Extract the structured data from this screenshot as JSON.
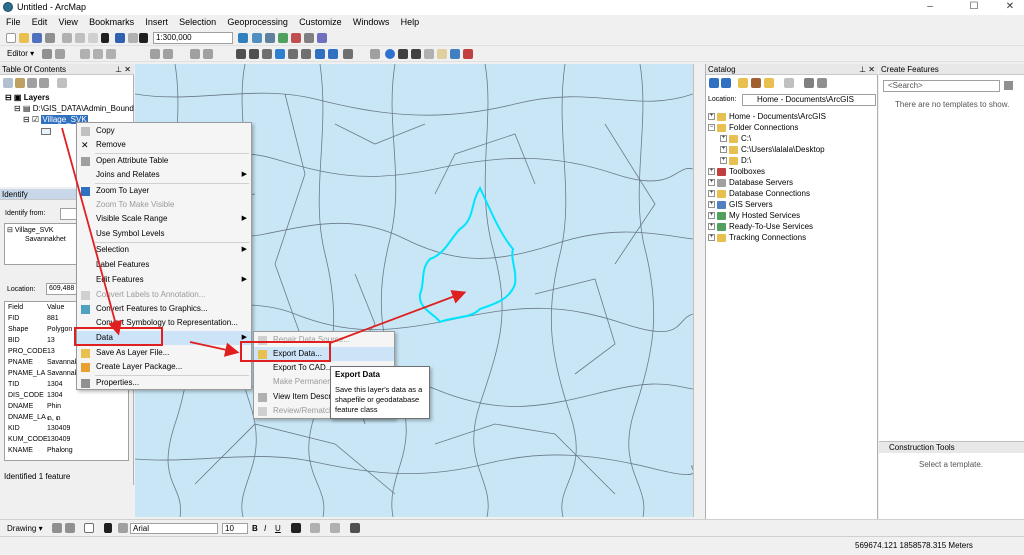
{
  "window": {
    "title": "Untitled - ArcMap",
    "minimize": "–",
    "maximize": "☐",
    "close": "✕"
  },
  "menu": [
    "File",
    "Edit",
    "View",
    "Bookmarks",
    "Insert",
    "Selection",
    "Geoprocessing",
    "Customize",
    "Windows",
    "Help"
  ],
  "toolbar": {
    "scale": "1:300,000",
    "editor_label": "Editor ▾"
  },
  "toc": {
    "title": "Table Of Contents",
    "layers_label": "Layers",
    "group_label": "D:\\GIS_DATA\\Admin_Bound",
    "layer_label": "Village_SVK"
  },
  "identify": {
    "title": "Identify",
    "identify_from_label": "Identify from:",
    "tree_layer": "Village_SVK",
    "tree_feature": "Savannakhet",
    "location_label": "Location:",
    "location_value": "609,488",
    "field_header": "Field",
    "value_header": "Value",
    "fields": [
      {
        "name": "FID",
        "value": "881"
      },
      {
        "name": "Shape",
        "value": "Polygon"
      },
      {
        "name": "BID",
        "value": "13"
      },
      {
        "name": "PRO_CODE",
        "value": "13"
      },
      {
        "name": "PNAME",
        "value": "Savannak"
      },
      {
        "name": "PNAME_LA",
        "value": "Savannak"
      },
      {
        "name": "TID",
        "value": "1304"
      },
      {
        "name": "DIS_CODE",
        "value": "1304"
      },
      {
        "name": "DNAME",
        "value": "Phin"
      },
      {
        "name": "DNAME_LA",
        "value": "ຄ, ຄ"
      },
      {
        "name": "KID",
        "value": "130409"
      },
      {
        "name": "KUM_CODE",
        "value": "130409"
      },
      {
        "name": "KNAME",
        "value": "Phalong"
      }
    ],
    "status": "Identified 1 feature"
  },
  "context_menu": {
    "items": [
      {
        "label": "Copy",
        "disabled": false,
        "submenu": false
      },
      {
        "label": "Remove",
        "disabled": false,
        "submenu": false
      },
      {
        "label": "Open Attribute Table",
        "disabled": false,
        "submenu": false
      },
      {
        "label": "Joins and Relates",
        "disabled": false,
        "submenu": true
      },
      {
        "label": "Zoom To Layer",
        "disabled": false,
        "submenu": false
      },
      {
        "label": "Zoom To Make Visible",
        "disabled": true,
        "submenu": false
      },
      {
        "label": "Visible Scale Range",
        "disabled": false,
        "submenu": true
      },
      {
        "label": "Use Symbol Levels",
        "disabled": false,
        "submenu": false
      },
      {
        "label": "Selection",
        "disabled": false,
        "submenu": true
      },
      {
        "label": "Label Features",
        "disabled": false,
        "submenu": false
      },
      {
        "label": "Edit Features",
        "disabled": false,
        "submenu": true
      },
      {
        "label": "Convert Labels to Annotation...",
        "disabled": true,
        "submenu": false
      },
      {
        "label": "Convert Features to Graphics...",
        "disabled": false,
        "submenu": false
      },
      {
        "label": "Convert Symbology to Representation...",
        "disabled": false,
        "submenu": false
      },
      {
        "label": "Data",
        "disabled": false,
        "submenu": true
      },
      {
        "label": "Save As Layer File...",
        "disabled": false,
        "submenu": false
      },
      {
        "label": "Create Layer Package...",
        "disabled": false,
        "submenu": false
      },
      {
        "label": "Properties...",
        "disabled": false,
        "submenu": false
      }
    ]
  },
  "data_submenu": {
    "items": [
      {
        "label": "Repair Data Source...",
        "disabled": true
      },
      {
        "label": "Export Data...",
        "disabled": false
      },
      {
        "label": "Export To CAD...",
        "disabled": false
      },
      {
        "label": "Make Permanent",
        "disabled": true
      },
      {
        "label": "View Item Description",
        "disabled": false
      },
      {
        "label": "Review/Rematch",
        "disabled": true
      }
    ]
  },
  "tooltip": {
    "title": "Export Data",
    "body": "Save this layer's data as a shapefile or geodatabase feature class"
  },
  "catalog": {
    "title": "Catalog",
    "location_label": "Location:",
    "location_value": "Home - Documents\\ArcGIS",
    "items": [
      {
        "label": "Home - Documents\\ArcGIS",
        "indent": 0,
        "expander": "+"
      },
      {
        "label": "Folder Connections",
        "indent": 0,
        "expander": "−"
      },
      {
        "label": "C:\\",
        "indent": 1,
        "expander": "+"
      },
      {
        "label": "C:\\Users\\lalala\\Desktop",
        "indent": 1,
        "expander": "+"
      },
      {
        "label": "D:\\",
        "indent": 1,
        "expander": "+"
      },
      {
        "label": "Toolboxes",
        "indent": 0,
        "expander": "+"
      },
      {
        "label": "Database Servers",
        "indent": 0,
        "expander": "+"
      },
      {
        "label": "Database Connections",
        "indent": 0,
        "expander": "+"
      },
      {
        "label": "GIS Servers",
        "indent": 0,
        "expander": "+"
      },
      {
        "label": "My Hosted Services",
        "indent": 0,
        "expander": "+"
      },
      {
        "label": "Ready-To-Use Services",
        "indent": 0,
        "expander": "+"
      },
      {
        "label": "Tracking Connections",
        "indent": 0,
        "expander": "+"
      }
    ]
  },
  "create_features": {
    "title": "Create Features",
    "search_placeholder": "<Search>",
    "no_templates": "There are no templates to show.",
    "construction_title": "Construction Tools",
    "select_template": "Select a template."
  },
  "drawing": {
    "label": "Drawing ▾",
    "font": "Arial",
    "size": "10",
    "bold": "B",
    "italic": "I",
    "underline": "U"
  },
  "status_bar": {
    "coordinates": "569674.121  1858578.315 Meters"
  },
  "colors": {
    "map_bg": "#c8e6f5",
    "selected_outline": "#00e5ff",
    "annotation_red": "#e02020",
    "highlight": "#cde3f7"
  }
}
